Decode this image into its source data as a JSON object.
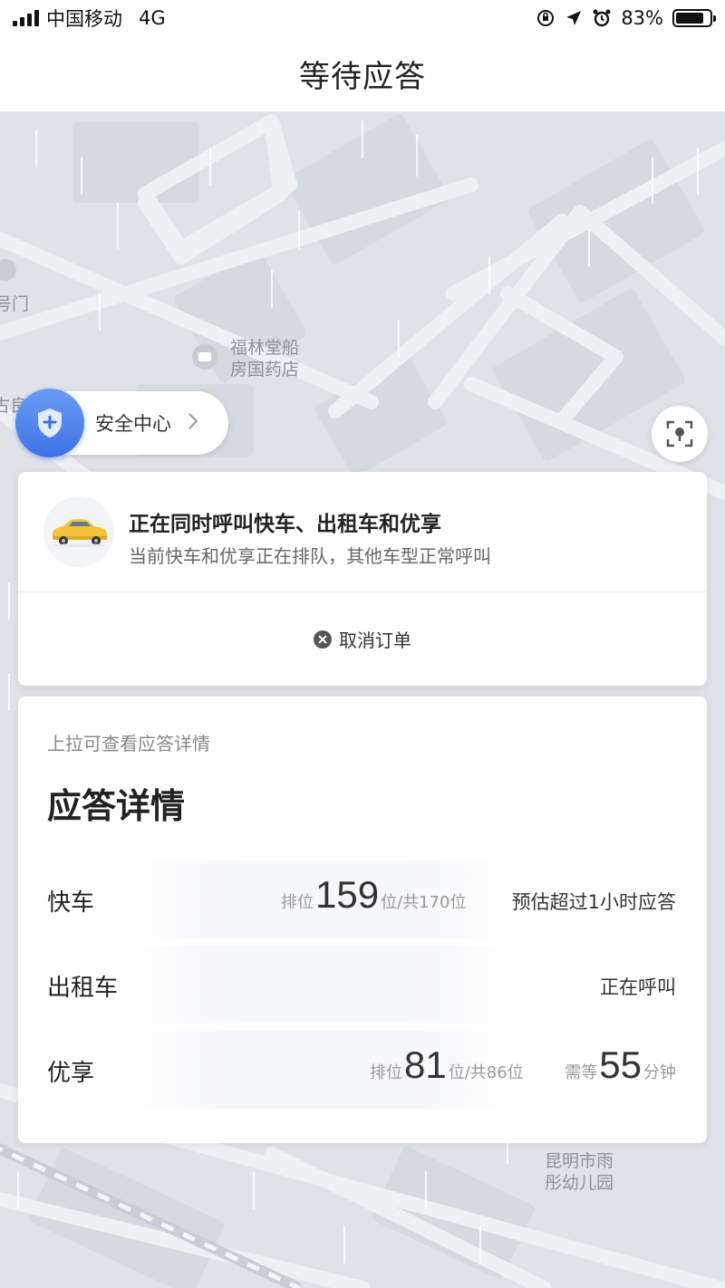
{
  "status_bar": {
    "carrier": "中国移动",
    "network": "4G",
    "battery": "83%",
    "battery_level": 0.83
  },
  "nav": {
    "title": "等待应答"
  },
  "map": {
    "pois": [
      {
        "name": "福林堂船\n房国药店"
      },
      {
        "name": "昆明市雨\n彤幼儿园"
      },
      {
        "name": "号门"
      },
      {
        "name": "古良"
      }
    ]
  },
  "safety_center": {
    "label": "安全中心"
  },
  "calling_card": {
    "title": "正在同时呼叫快车、出租车和优享",
    "subtitle": "当前快车和优享正在排队，其他车型正常呼叫",
    "cancel_label": "取消订单"
  },
  "details": {
    "hint": "上拉可查看应答详情",
    "title": "应答详情",
    "rows": [
      {
        "name": "快车",
        "queue_prefix": "排位",
        "queue_pos": "159",
        "queue_suffix": "位/共170位",
        "status": "预估超过1小时应答"
      },
      {
        "name": "出租车",
        "status": "正在呼叫"
      },
      {
        "name": "优享",
        "queue_prefix": "排位",
        "queue_pos": "81",
        "queue_suffix": "位/共86位",
        "wait_prefix": "需等",
        "wait_value": "55",
        "wait_suffix": "分钟"
      }
    ]
  },
  "colors": {
    "accent_blue": "#3f72e6",
    "map_bg": "#dfe3e8",
    "road": "#eef0f3"
  }
}
